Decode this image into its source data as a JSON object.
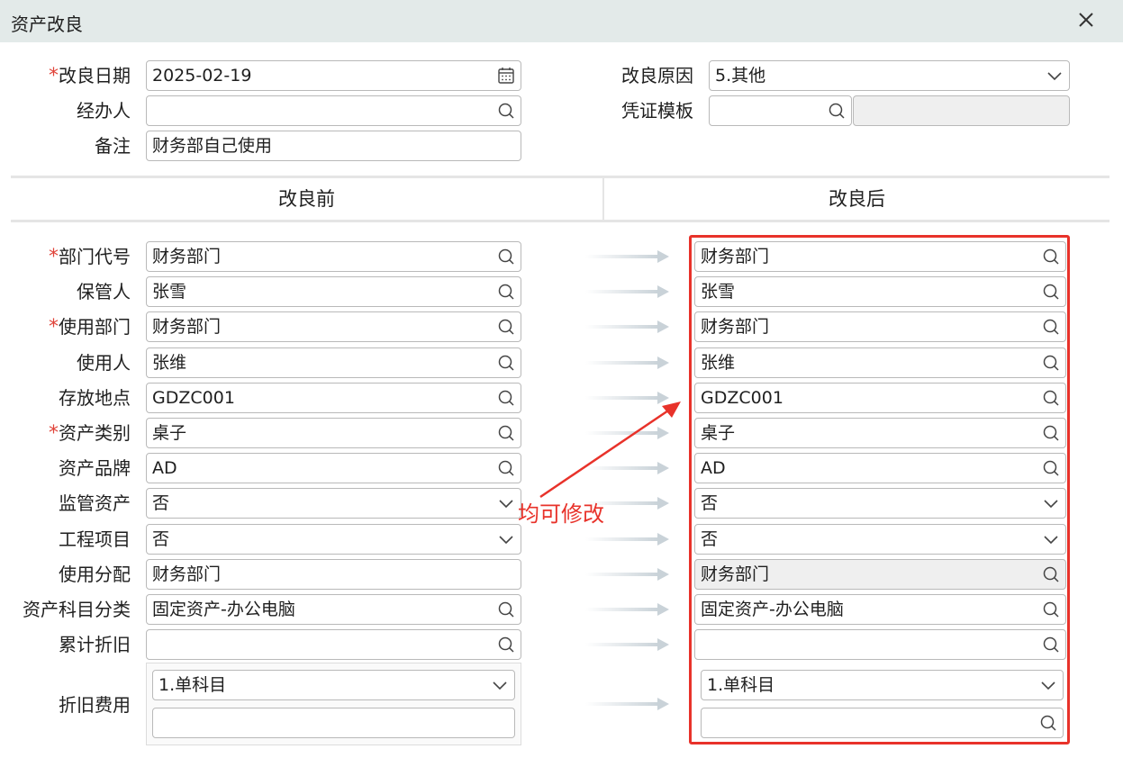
{
  "window": {
    "title": "资产改良"
  },
  "header_fields": {
    "date": {
      "label": "改良日期",
      "required": true,
      "value": "2025-02-19"
    },
    "handler": {
      "label": "经办人",
      "value": ""
    },
    "remark": {
      "label": "备注",
      "value": "财务部自己使用"
    },
    "reason": {
      "label": "改良原因",
      "value": "5.其他"
    },
    "voucher": {
      "label": "凭证模板",
      "value": "",
      "extra": ""
    }
  },
  "sections": {
    "before": "改良前",
    "after": "改良后"
  },
  "rows": [
    {
      "label": "部门代号",
      "required": true,
      "before": "财务部门",
      "after": "财务部门"
    },
    {
      "label": "保管人",
      "required": false,
      "before": "张雪",
      "after": "张雪"
    },
    {
      "label": "使用部门",
      "required": true,
      "before": "财务部门",
      "after": "财务部门"
    },
    {
      "label": "使用人",
      "required": false,
      "before": "张维",
      "after": "张维"
    },
    {
      "label": "存放地点",
      "required": false,
      "before": "GDZC001",
      "after": "GDZC001"
    },
    {
      "label": "资产类别",
      "required": true,
      "before": "桌子",
      "after": "桌子"
    },
    {
      "label": "资产品牌",
      "required": false,
      "before": "AD",
      "after": "AD"
    },
    {
      "label": "监管资产",
      "required": false,
      "before": "否",
      "after": "否"
    },
    {
      "label": "工程项目",
      "required": false,
      "before": "否",
      "after": "否"
    },
    {
      "label": "使用分配",
      "required": false,
      "before": "财务部门",
      "after": "财务部门"
    },
    {
      "label": "资产科目分类",
      "required": false,
      "before": "固定资产-办公电脑",
      "after": "固定资产-办公电脑"
    },
    {
      "label": "累计折旧",
      "required": false,
      "before": "",
      "after": ""
    }
  ],
  "depreciation": {
    "label": "折旧费用",
    "before_type": "1.单科目",
    "before_account": "",
    "after_type": "1.单科目",
    "after_account": ""
  },
  "annotation": {
    "text": "均可修改",
    "color": "#e8322a"
  },
  "colors": {
    "required_star": "#e0443a",
    "titlebar": "#e3eae9"
  }
}
